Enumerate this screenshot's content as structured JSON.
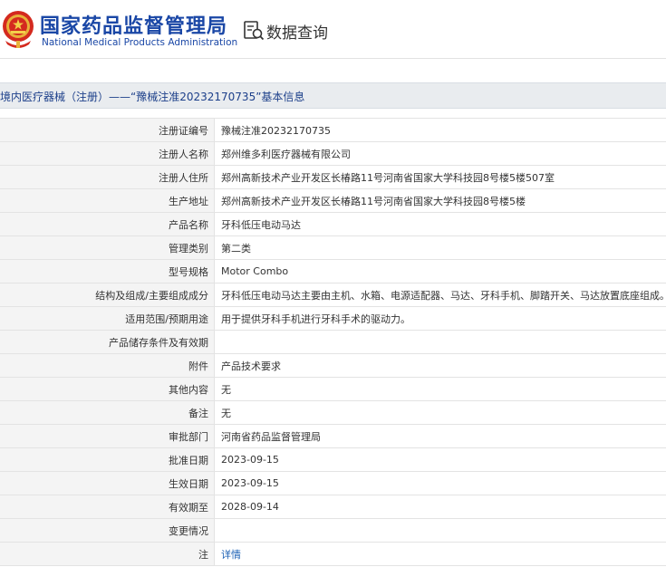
{
  "header": {
    "agency_cn": "国家药品监督管理局",
    "agency_en": "National Medical Products Administration",
    "query_title": "数据查询",
    "brand_color": "#1a47a6"
  },
  "section": {
    "title": "境内医疗器械（注册）——“豫械注准20232170735”基本信息"
  },
  "rows": [
    {
      "label": "注册证编号",
      "value": "豫械注准20232170735"
    },
    {
      "label": "注册人名称",
      "value": "郑州维多利医疗器械有限公司"
    },
    {
      "label": "注册人住所",
      "value": "郑州高新技术产业开发区长椿路11号河南省国家大学科技园8号楼5楼507室"
    },
    {
      "label": "生产地址",
      "value": "郑州高新技术产业开发区长椿路11号河南省国家大学科技园8号楼5楼"
    },
    {
      "label": "产品名称",
      "value": "牙科低压电动马达"
    },
    {
      "label": "管理类别",
      "value": "第二类"
    },
    {
      "label": "型号规格",
      "value": "Motor Combo"
    },
    {
      "label": "结构及组成/主要组成成分",
      "value": "牙科低压电动马达主要由主机、水箱、电源适配器、马达、牙科手机、脚踏开关、马达放置底座组成。"
    },
    {
      "label": "适用范围/预期用途",
      "value": "用于提供牙科手机进行牙科手术的驱动力。"
    },
    {
      "label": "产品储存条件及有效期",
      "value": ""
    },
    {
      "label": "附件",
      "value": "产品技术要求"
    },
    {
      "label": "其他内容",
      "value": "无"
    },
    {
      "label": "备注",
      "value": "无"
    },
    {
      "label": "审批部门",
      "value": "河南省药品监督管理局"
    },
    {
      "label": "批准日期",
      "value": "2023-09-15"
    },
    {
      "label": "生效日期",
      "value": "2023-09-15"
    },
    {
      "label": "有效期至",
      "value": "2028-09-14"
    },
    {
      "label": "变更情况",
      "value": ""
    },
    {
      "label": "注",
      "value": "详情"
    }
  ]
}
